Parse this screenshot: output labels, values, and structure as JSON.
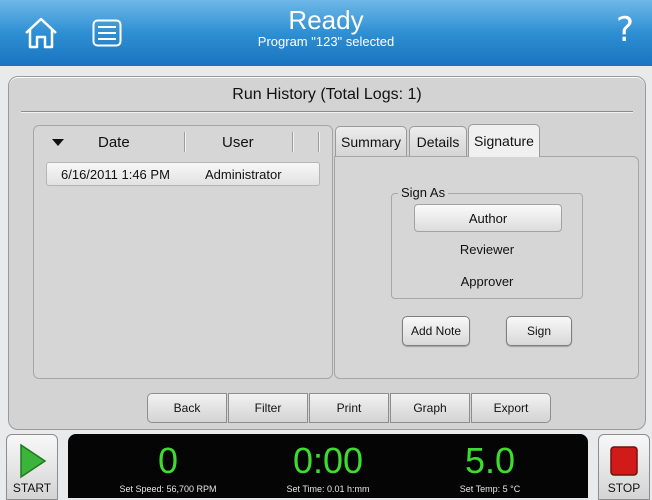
{
  "header": {
    "title": "Ready",
    "subtitle": "Program \"123\" selected",
    "help_glyph": "?",
    "home_icon": "home-icon",
    "menu_icon": "list-menu-icon"
  },
  "panel": {
    "title": "Run History (Total Logs: 1)"
  },
  "list": {
    "columns": [
      "Date",
      "User"
    ],
    "rows": [
      {
        "date": "6/16/2011 1:46 PM",
        "user": "Administrator"
      }
    ]
  },
  "tabs": [
    {
      "label": "Summary"
    },
    {
      "label": "Details"
    },
    {
      "label": "Signature",
      "active": true
    }
  ],
  "signature": {
    "legend": "Sign As",
    "options": [
      {
        "label": "Author",
        "selected": true
      },
      {
        "label": "Reviewer"
      },
      {
        "label": "Approver"
      }
    ],
    "add_note_label": "Add Note",
    "sign_label": "Sign"
  },
  "bottom_bar": [
    "Back",
    "Filter",
    "Print",
    "Graph",
    "Export"
  ],
  "footer": {
    "start_label": "START",
    "stop_label": "STOP",
    "speed_value": "0",
    "speed_set": "Set Speed: 56,700 RPM",
    "time_value": "0:00",
    "time_set": "Set Time: 0.01 h:mm",
    "temp_value": "5.0",
    "temp_set": "Set Temp: 5 °C"
  },
  "colors": {
    "header_blue": "#2e8fd3",
    "readout_green": "#3ddc2e",
    "start_green": "#3cb43c",
    "stop_red": "#d11a1a"
  }
}
